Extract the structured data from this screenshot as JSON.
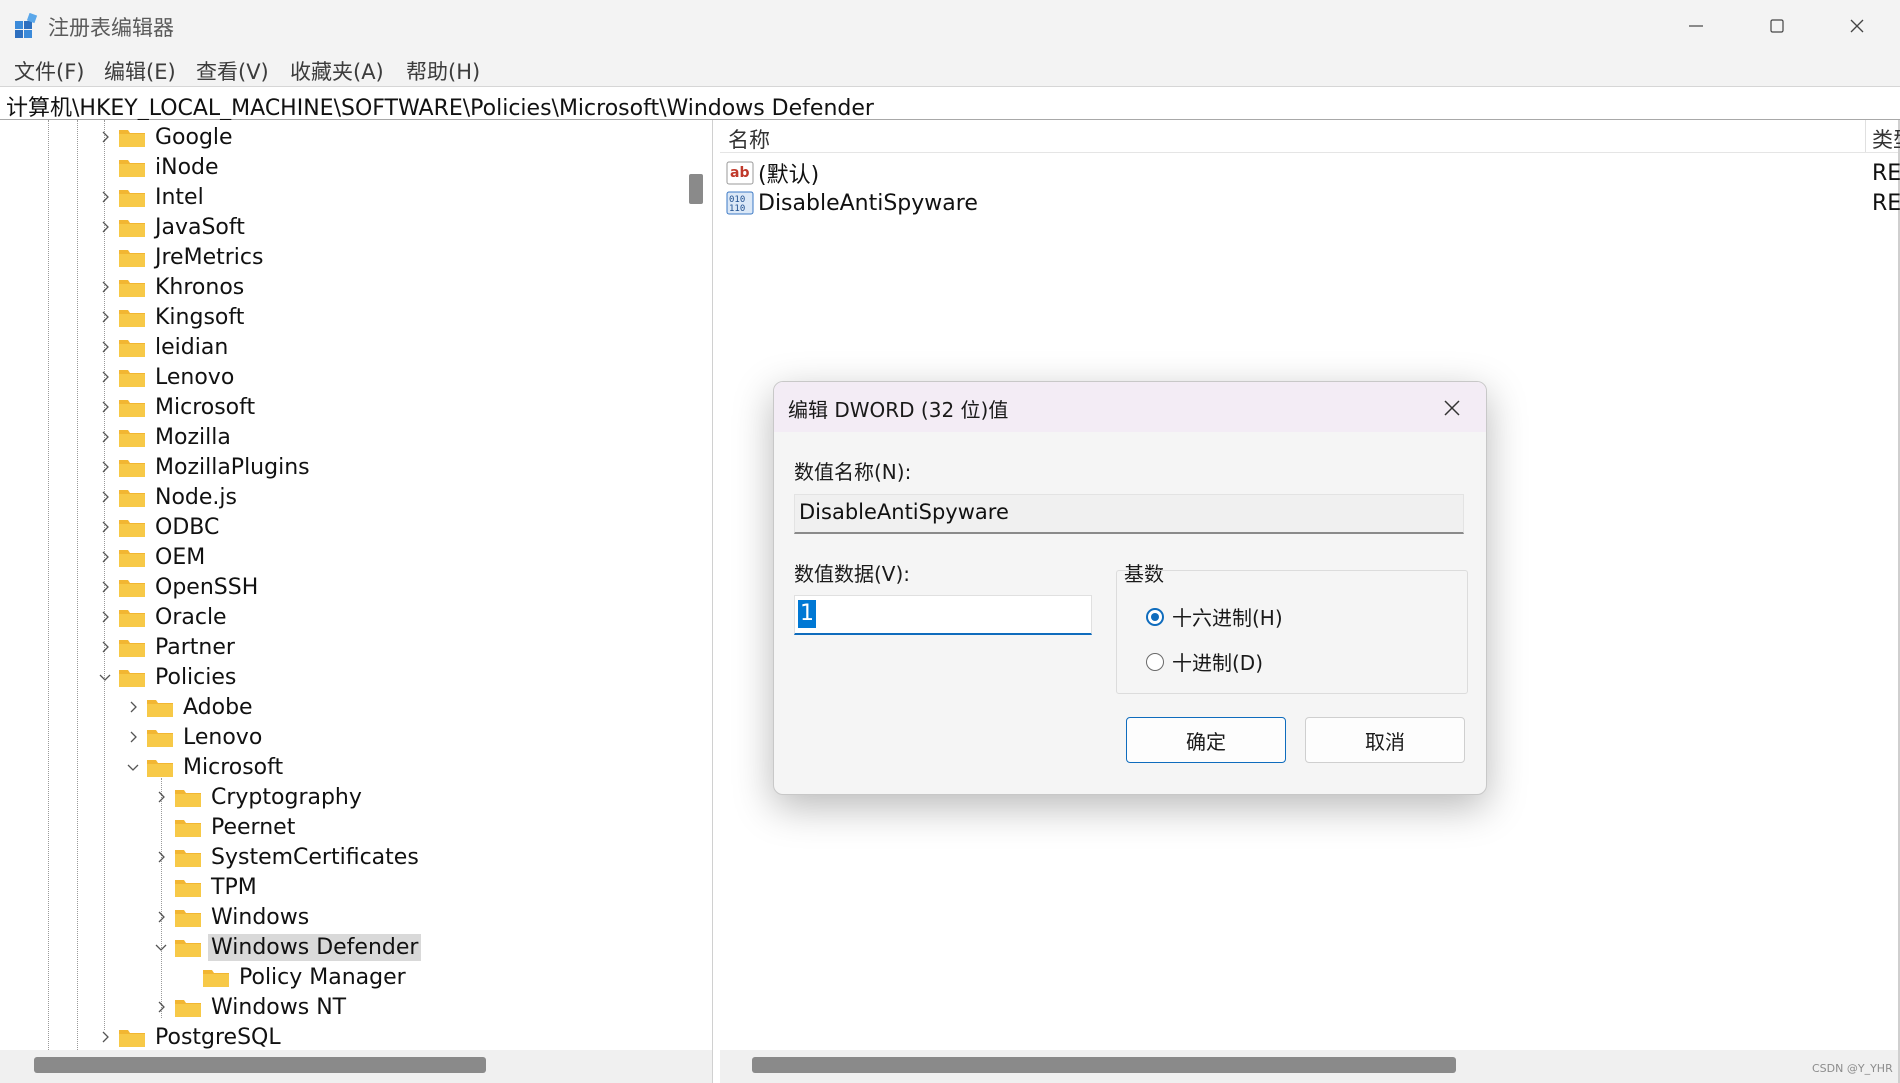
{
  "window": {
    "title": "注册表编辑器",
    "icon": "registry-editor-icon"
  },
  "menu": [
    "文件(F)",
    "编辑(E)",
    "查看(V)",
    "收藏夹(A)",
    "帮助(H)"
  ],
  "address": "计算机\\HKEY_LOCAL_MACHINE\\SOFTWARE\\Policies\\Microsoft\\Windows Defender",
  "tree": {
    "items": [
      {
        "label": "Google",
        "state": "collapsed",
        "level": 0
      },
      {
        "label": "iNode",
        "state": "none",
        "level": 0
      },
      {
        "label": "Intel",
        "state": "collapsed",
        "level": 0
      },
      {
        "label": "JavaSoft",
        "state": "collapsed",
        "level": 0
      },
      {
        "label": "JreMetrics",
        "state": "none",
        "level": 0
      },
      {
        "label": "Khronos",
        "state": "collapsed",
        "level": 0
      },
      {
        "label": "Kingsoft",
        "state": "collapsed",
        "level": 0
      },
      {
        "label": "leidian",
        "state": "collapsed",
        "level": 0
      },
      {
        "label": "Lenovo",
        "state": "collapsed",
        "level": 0
      },
      {
        "label": "Microsoft",
        "state": "collapsed",
        "level": 0
      },
      {
        "label": "Mozilla",
        "state": "collapsed",
        "level": 0
      },
      {
        "label": "MozillaPlugins",
        "state": "collapsed",
        "level": 0
      },
      {
        "label": "Node.js",
        "state": "collapsed",
        "level": 0
      },
      {
        "label": "ODBC",
        "state": "collapsed",
        "level": 0
      },
      {
        "label": "OEM",
        "state": "collapsed",
        "level": 0
      },
      {
        "label": "OpenSSH",
        "state": "collapsed",
        "level": 0
      },
      {
        "label": "Oracle",
        "state": "collapsed",
        "level": 0
      },
      {
        "label": "Partner",
        "state": "collapsed",
        "level": 0
      },
      {
        "label": "Policies",
        "state": "expanded",
        "level": 0
      },
      {
        "label": "Adobe",
        "state": "collapsed",
        "level": 1
      },
      {
        "label": "Lenovo",
        "state": "collapsed",
        "level": 1
      },
      {
        "label": "Microsoft",
        "state": "expanded",
        "level": 1
      },
      {
        "label": "Cryptography",
        "state": "collapsed",
        "level": 2
      },
      {
        "label": "Peernet",
        "state": "none",
        "level": 2
      },
      {
        "label": "SystemCertificates",
        "state": "collapsed",
        "level": 2
      },
      {
        "label": "TPM",
        "state": "none",
        "level": 2
      },
      {
        "label": "Windows",
        "state": "collapsed",
        "level": 2
      },
      {
        "label": "Windows Defender",
        "state": "expanded",
        "level": 2,
        "selected": true
      },
      {
        "label": "Policy Manager",
        "state": "none",
        "level": 3
      },
      {
        "label": "Windows NT",
        "state": "collapsed",
        "level": 2
      },
      {
        "label": "PostgreSQL",
        "state": "collapsed",
        "level": 0
      }
    ]
  },
  "values_pane": {
    "column_name": "名称",
    "column_type": "类型",
    "rows": [
      {
        "name": "(默认)",
        "type": "RE",
        "icon": "string-value-icon"
      },
      {
        "name": "DisableAntiSpyware",
        "type": "RE",
        "icon": "binary-value-icon"
      }
    ],
    "watermark": "CSDN @Y_YHR"
  },
  "dialog": {
    "title": "编辑 DWORD (32 位)值",
    "value_name_label": "数值名称(N):",
    "value_name": "DisableAntiSpyware",
    "value_data_label": "数值数据(V):",
    "value_data": "1",
    "base_label": "基数",
    "hex_label": "十六进制(H)",
    "dec_label": "十进制(D)",
    "base_selected": "hex",
    "ok_label": "确定",
    "cancel_label": "取消"
  },
  "colors": {
    "accent": "#0f6cbd",
    "folder": "#f7c948",
    "selection": "#0078d4"
  }
}
